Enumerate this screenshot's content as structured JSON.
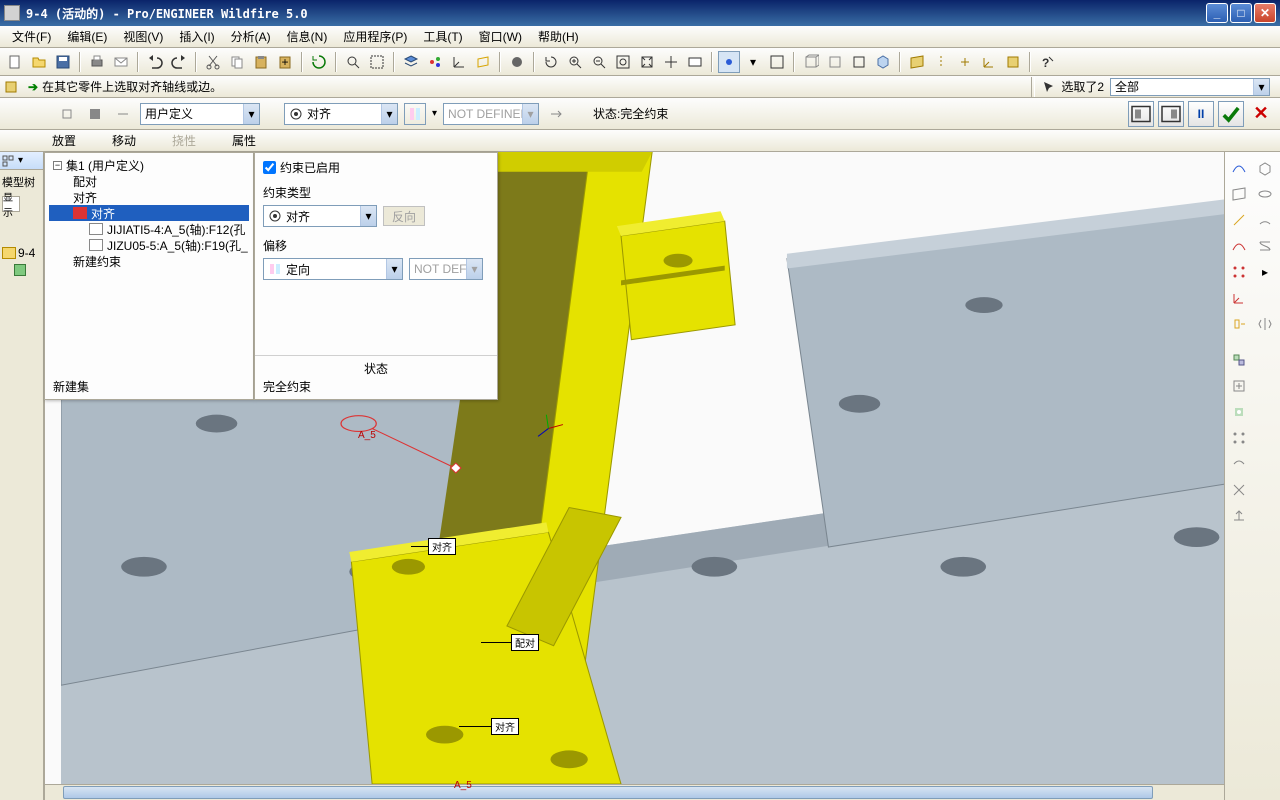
{
  "title": "9-4 (活动的) - Pro/ENGINEER Wildfire 5.0",
  "menus": [
    "文件(F)",
    "编辑(E)",
    "视图(V)",
    "插入(I)",
    "分析(A)",
    "信息(N)",
    "应用程序(P)",
    "工具(T)",
    "窗口(W)",
    "帮助(H)"
  ],
  "info_prompt": "在其它零件上选取对齐轴线或边。",
  "selection_label": "选取了2",
  "selection_filter": "全部",
  "constraint_toolbar": {
    "set_combo": "用户定义",
    "type_combo": "对齐",
    "offset_combo_placeholder": "NOT DEFINED",
    "status_label": "状态:",
    "status_value": "完全约束"
  },
  "tabs": {
    "placement": "放置",
    "move": "移动",
    "flex": "挠性",
    "props": "属性"
  },
  "tree_strip": {
    "header": "模型树",
    "btn": "显示",
    "root": "9-4"
  },
  "panel_left": {
    "root": "集1 (用户定义)",
    "children": [
      "配对",
      "对齐",
      "对齐"
    ],
    "refs": [
      "JIJIATI5-4:A_5(轴):F12(孔",
      "JIZU05-5:A_5(轴):F19(孔_"
    ],
    "new_constraint": "新建约束",
    "new_set": "新建集"
  },
  "panel_right": {
    "enabled_label": "约束已启用",
    "type_label": "约束类型",
    "type_value": "对齐",
    "reverse_btn": "反向",
    "offset_label": "偏移",
    "offset_value": "定向",
    "offset_field_placeholder": "NOT DEFIN",
    "status_label": "状态",
    "status_value": "完全约束"
  },
  "viewport_annot": {
    "a5_top": "A_5",
    "align_mid": "对齐",
    "pair_low": "配对",
    "align_bottom": "对齐",
    "a5_bottom": "A_5"
  }
}
